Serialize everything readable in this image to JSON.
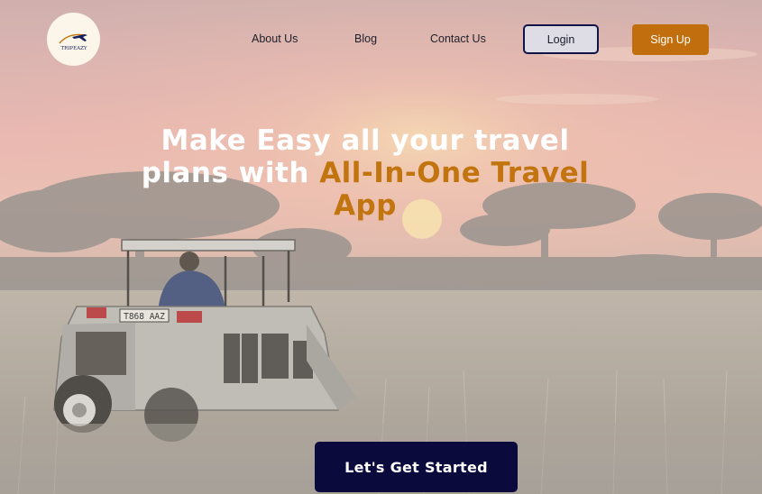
{
  "brand": {
    "logo_text": "TRIPEAZY",
    "logo_icon": "airplane-icon"
  },
  "nav": {
    "links": [
      {
        "label": "About Us"
      },
      {
        "label": "Blog"
      },
      {
        "label": "Contact Us"
      }
    ],
    "login_label": "Login",
    "signup_label": "Sign Up"
  },
  "hero": {
    "headline_part1": "Make Easy all your travel plans with ",
    "headline_accent": "All-In-One Travel App",
    "cta_label": "Let's Get Started",
    "vehicle_plate": "T868 AAZ",
    "background_scene": "safari-jeep-savanna-sunset"
  },
  "colors": {
    "accent": "#c16f0e",
    "navy": "#0b0a3d",
    "login_border": "#121446"
  }
}
